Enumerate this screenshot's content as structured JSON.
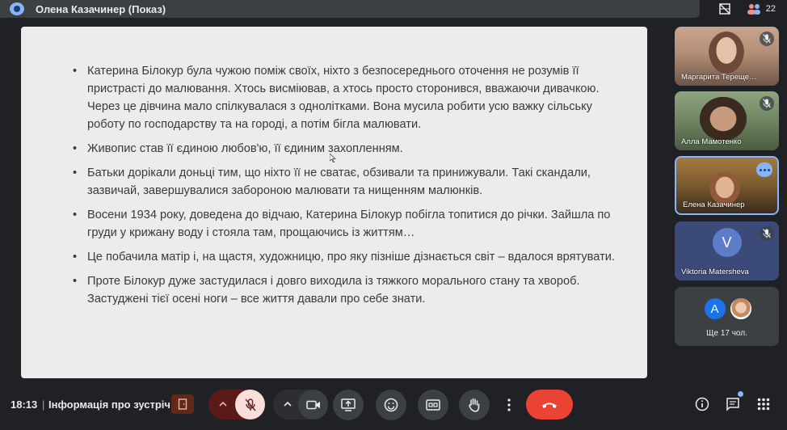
{
  "header": {
    "presenter_title": "Олена Казачинер (Показ)",
    "participant_count": "22"
  },
  "slide": {
    "bullets": [
      "Катерина Білокур була чужою поміж своїх, ніхто з безпосереднього оточення не розумів її пристрасті до малювання. Хтось висміював, а хтось просто сторонився, вважаючи дивачкою. Через це дівчина мало спілкувалася з однолітками. Вона мусила робити усю важку сільську роботу по господарству та на городі, а потім бігла малювати.",
      "Живопис став її єдиною любов'ю, її єдиним захопленням.",
      "Батьки дорікали доньці тим, що ніхто її не сватає, обзивали та принижували. Такі скандали, зазвичай, завершувалися забороною малювати та нищенням малюнків.",
      "Восени 1934 року, доведена до відчаю, Катерина Білокур побігла топитися до річки. Зайшла по груди у крижану воду і стояла там, прощаючись із життям…",
      "Це побачила матір і, на щастя, художницю, про яку пізніше дізнається світ – вдалося врятувати.",
      "Проте Білокур дуже застудилася і довго виходила із тяжкого морального стану та хвороб. Застуджені тієї осені ноги – все життя давали про себе знати."
    ]
  },
  "participants": [
    {
      "name": "Маргарита Тереще…",
      "muted": true
    },
    {
      "name": "Алла Мамотенко",
      "muted": true
    },
    {
      "name": "Елена Казачинер",
      "muted": false
    },
    {
      "name": "Viktoria Matersheva",
      "initial": "V",
      "muted": true
    }
  ],
  "more_participants": {
    "initial": "A",
    "label": "Ще 17 чол."
  },
  "bottom": {
    "time": "18:13",
    "separator": "|",
    "meeting_info": "Інформація про зустріч"
  },
  "colors": {
    "background": "#202124",
    "slide_bg": "#ececec",
    "end_call": "#ea4335",
    "mic_muted_bg": "#f9dedc",
    "accent": "#8ab4f8"
  }
}
